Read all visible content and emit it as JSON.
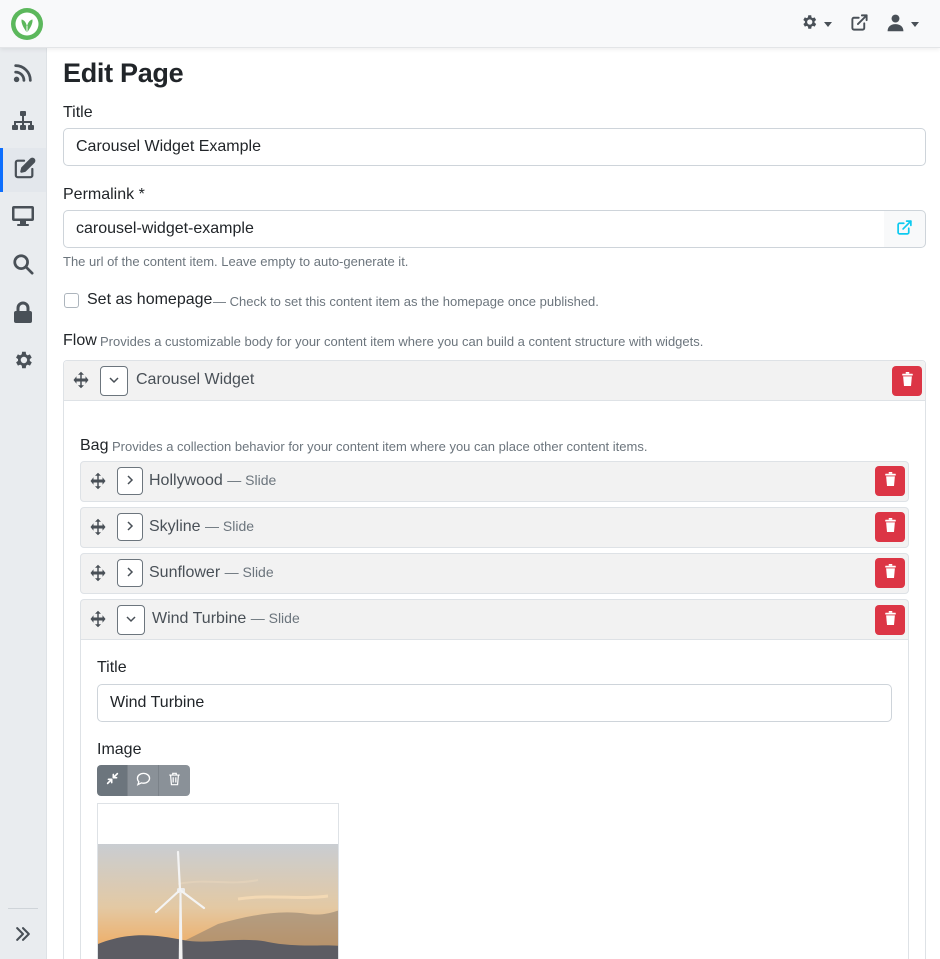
{
  "topbar": {
    "logo": "orchard-leaf-logo",
    "icons": [
      "gear-icon",
      "external-link-icon",
      "user-icon"
    ]
  },
  "sidebar": {
    "items": [
      {
        "name": "rss-icon"
      },
      {
        "name": "sitemap-icon"
      },
      {
        "name": "edit-icon",
        "active": true
      },
      {
        "name": "desktop-icon"
      },
      {
        "name": "search-icon"
      },
      {
        "name": "lock-icon"
      },
      {
        "name": "cog-icon"
      }
    ],
    "collapse_icon": "double-chevron-right-icon"
  },
  "page": {
    "title": "Edit Page",
    "title_field": {
      "label": "Title",
      "value": "Carousel Widget Example"
    },
    "permalink": {
      "label": "Permalink *",
      "value": "carousel-widget-example",
      "hint": "The url of the content item. Leave empty to auto-generate it."
    },
    "homepage": {
      "label": "Set as homepage",
      "hint": "— Check to set this content item as the homepage once published.",
      "checked": false
    },
    "flow": {
      "label": "Flow",
      "hint": "Provides a customizable body for your content item where you can build a content structure with widgets."
    },
    "carousel_widget": {
      "title": "Carousel Widget",
      "bag": {
        "label": "Bag",
        "hint": "Provides a collection behavior for your content item where you can place other content items."
      },
      "slides": [
        {
          "name": "Hollywood",
          "type": "— Slide",
          "expanded": false
        },
        {
          "name": "Skyline",
          "type": "— Slide",
          "expanded": false
        },
        {
          "name": "Sunflower",
          "type": "— Slide",
          "expanded": false
        },
        {
          "name": "Wind Turbine",
          "type": "— Slide",
          "expanded": true
        }
      ],
      "expanded_slide": {
        "title_label": "Title",
        "title_value": "Wind Turbine",
        "image_label": "Image",
        "image_toolbar": [
          "compress-icon",
          "comment-icon",
          "trash-icon"
        ]
      }
    }
  },
  "colors": {
    "accent": "#0d6efd",
    "danger": "#dc3545",
    "logo_green": "#5cb85c",
    "link_blue": "#0dcaf0"
  }
}
